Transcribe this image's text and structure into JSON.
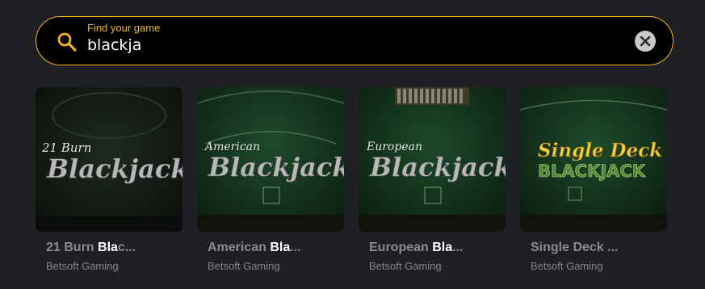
{
  "search": {
    "label": "Find your game",
    "value": "blackja"
  },
  "colors": {
    "accent": "#f2b51c",
    "background": "#1f2023",
    "title_dim": "#8a8b8f",
    "title_highlight": "#ffffff"
  },
  "games": [
    {
      "title_highlight": "Bla",
      "title_before": "21 Burn ",
      "title_after": "c...",
      "provider": "Betsoft Gaming",
      "logo_top": "21 Burn",
      "logo_main": "Blackjack"
    },
    {
      "title_highlight": "Bla",
      "title_before": "American ",
      "title_after": "...",
      "provider": "Betsoft Gaming",
      "logo_top": "American",
      "logo_main": "Blackjack"
    },
    {
      "title_highlight": "Bla",
      "title_before": "European ",
      "title_after": "...",
      "provider": "Betsoft Gaming",
      "logo_top": "European",
      "logo_main": "Blackjack"
    },
    {
      "title_highlight": "",
      "title_before": "Single Deck ...",
      "title_after": "",
      "provider": "Betsoft Gaming",
      "logo_top": "Single Deck",
      "logo_main": "BLACKJACK"
    }
  ],
  "icons": {
    "search": "search-icon",
    "clear": "close-icon"
  }
}
